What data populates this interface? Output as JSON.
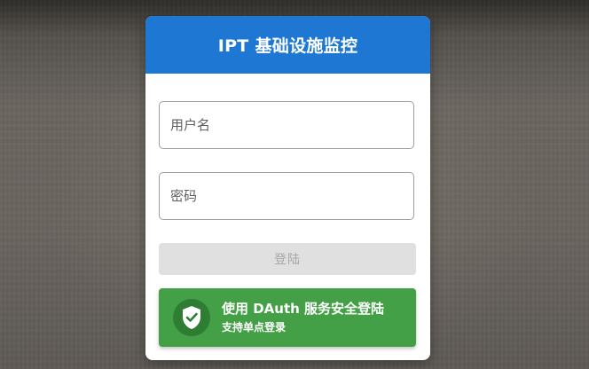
{
  "header": {
    "title": "IPT 基础设施监控"
  },
  "form": {
    "username_placeholder": "用户名",
    "password_placeholder": "密码",
    "login_label": "登陆"
  },
  "dauth": {
    "main_label": "使用 DAuth 服务安全登陆",
    "sub_label": "支持单点登录",
    "icon": "shield-check-icon"
  },
  "colors": {
    "header_bg": "#1e78d3",
    "dauth_bg": "#43a047",
    "dauth_icon_bg": "#2e7d32",
    "login_disabled_bg": "#e0e0e0"
  }
}
